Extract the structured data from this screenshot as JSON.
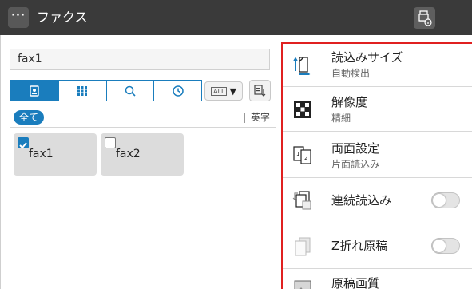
{
  "header": {
    "menu_label": "···",
    "title": "ファクス",
    "menu_icon": "more-dots-icon",
    "right_icon": "fax-info-icon"
  },
  "destination_input": {
    "value": "fax1"
  },
  "toolbar": {
    "tabs": [
      {
        "icon": "address-book-icon",
        "active": true
      },
      {
        "icon": "grid-icon",
        "active": false
      },
      {
        "icon": "search-icon",
        "active": false
      },
      {
        "icon": "clock-history-icon",
        "active": false
      }
    ],
    "all_label": "ALL",
    "all_caret": "▼",
    "sort_icon": "sort-icon"
  },
  "index": {
    "selected": "全て",
    "alpha": "英字"
  },
  "destinations": [
    {
      "name": "fax1",
      "checked": true
    },
    {
      "name": "fax2",
      "checked": false
    }
  ],
  "settings": [
    {
      "title": "読込みサイズ",
      "value": "自動検出",
      "icon": "original-size-icon"
    },
    {
      "title": "解像度",
      "value": "精細",
      "icon": "resolution-icon"
    },
    {
      "title": "両面設定",
      "value": "片面読込み",
      "icon": "duplex-icon"
    },
    {
      "title": "連続読込み",
      "icon": "separate-scan-icon",
      "toggle": false
    },
    {
      "title": "Z折れ原稿",
      "icon": "z-fold-icon",
      "toggle": false
    },
    {
      "title": "原稿画質",
      "icon": "original-type-icon"
    }
  ],
  "colors": {
    "header_bg": "#3a3a3a",
    "accent": "#1a7dbd",
    "highlight_border": "#e02020"
  }
}
